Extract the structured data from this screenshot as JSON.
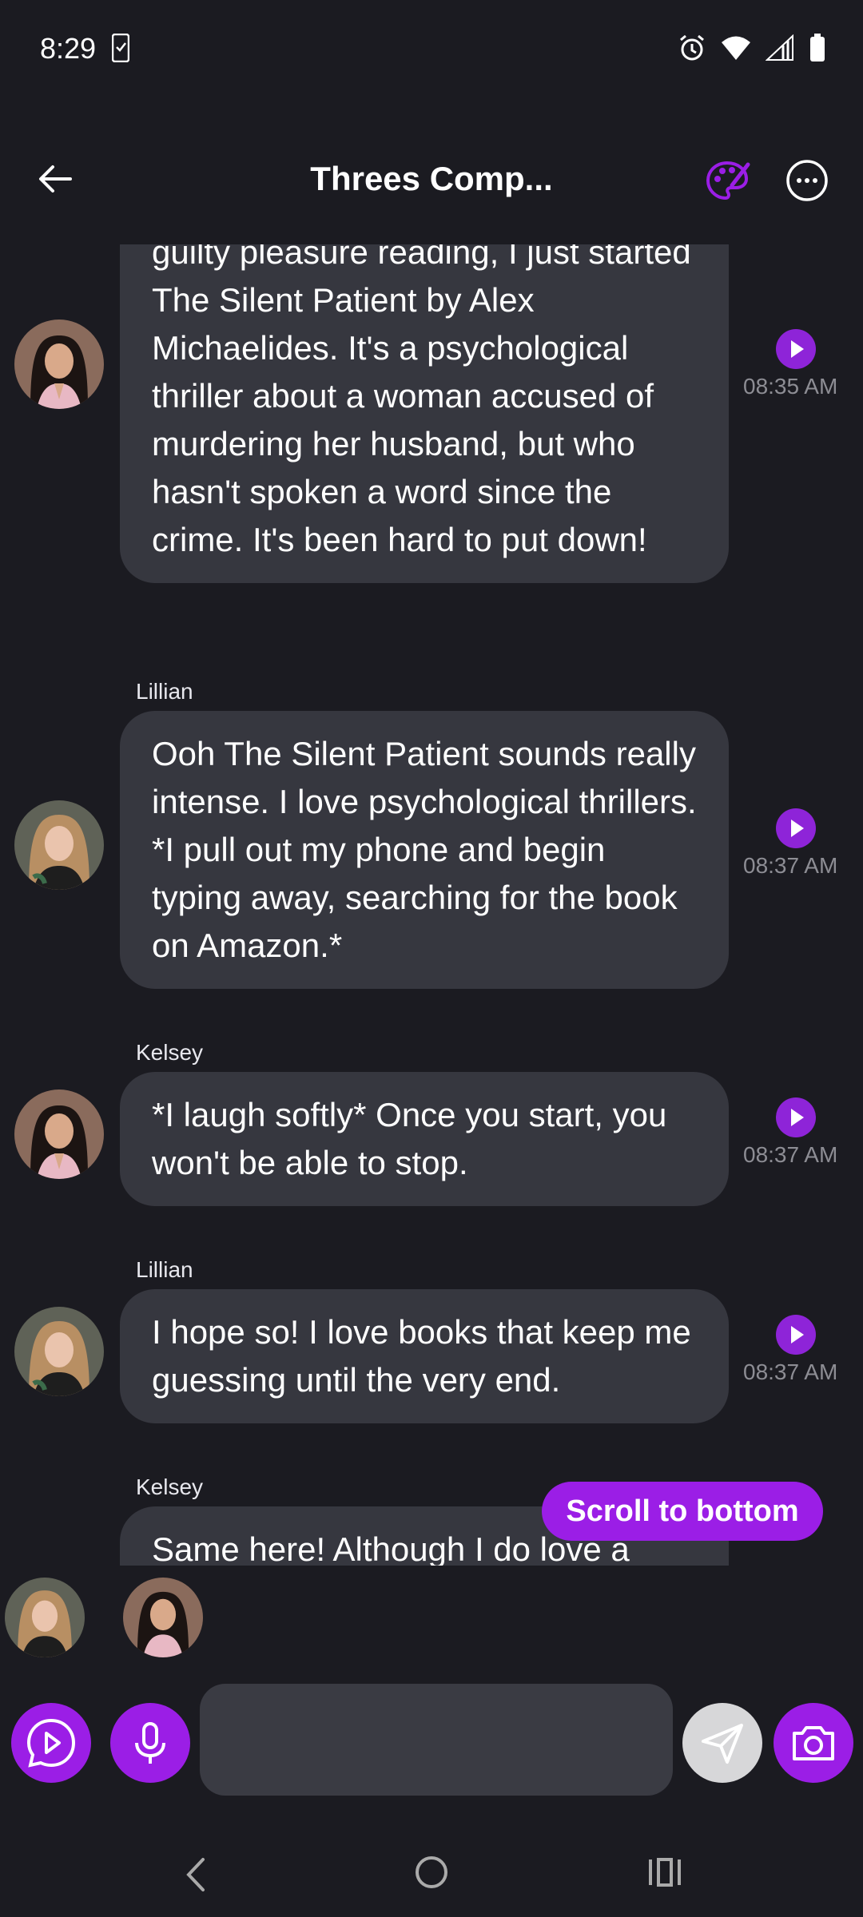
{
  "status": {
    "time": "8:29"
  },
  "header": {
    "title": "Threes Comp..."
  },
  "messages": [
    {
      "sender": "",
      "text": "guilty pleasure reading, I just started The Silent Patient by Alex Michaelides. It's a psychological thriller about a woman accused of murdering her husband, but who hasn't spoken a word since the crime. It's been hard to put down!",
      "time": "08:35 AM"
    },
    {
      "sender": "Lillian",
      "text": "Ooh The Silent Patient sounds really intense. I love psychological thrillers. *I pull out my phone and begin typing away, searching for the book on Amazon.*",
      "time": "08:37 AM"
    },
    {
      "sender": "Kelsey",
      "text": "*I laugh softly* Once you start, you won't be able to stop.",
      "time": "08:37 AM"
    },
    {
      "sender": "Lillian",
      "text": "I hope so! I love books that keep me guessing until the very end.",
      "time": "08:37 AM"
    },
    {
      "sender": "Kelsey",
      "text": "Same here! Although I do love a",
      "time": ""
    }
  ],
  "scroll_to_bottom": "Scroll to bottom",
  "colors": {
    "accent": "#9b1ee6",
    "background": "#1b1b21",
    "bubble": "#36373f"
  }
}
